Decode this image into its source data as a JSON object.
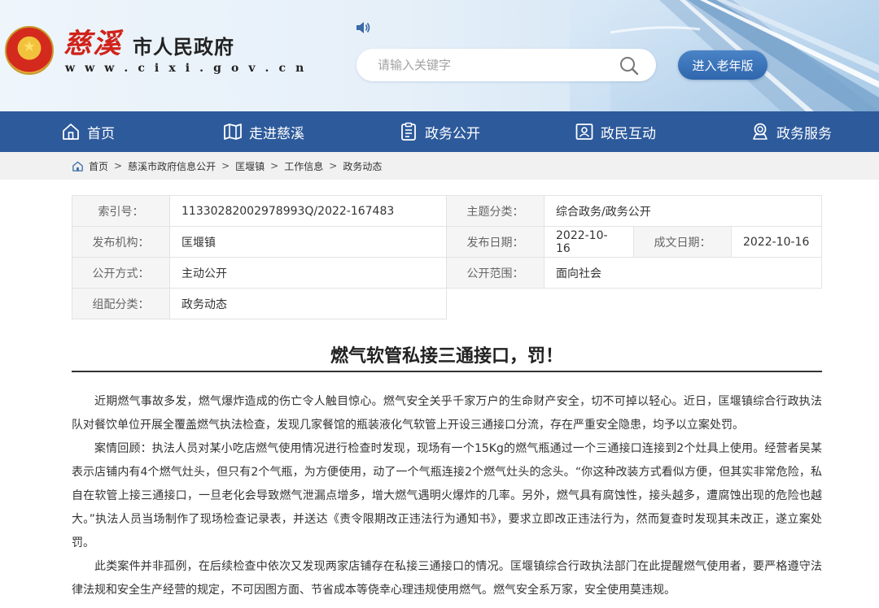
{
  "header": {
    "logo_cursive": "慈溪",
    "site_title": "市人民政府",
    "site_url": "w w w . c i x i . g o v . c n",
    "search_placeholder": "请输入关键字",
    "elder_mode_label": "进入老年版"
  },
  "nav": [
    {
      "label": "首页",
      "icon": "home-icon"
    },
    {
      "label": "走进慈溪",
      "icon": "map-icon"
    },
    {
      "label": "政务公开",
      "icon": "document-list-icon"
    },
    {
      "label": "政民互动",
      "icon": "portrait-icon"
    },
    {
      "label": "政务服务",
      "icon": "service-badge-icon"
    }
  ],
  "breadcrumb": [
    "首页",
    "慈溪市政府信息公开",
    "匡堰镇",
    "工作信息",
    "政务动态"
  ],
  "meta": {
    "index_label": "索引号：",
    "index_value": "11330282002978993Q/2022-167483",
    "topic_label": "主题分类：",
    "topic_value": "综合政务/政务公开",
    "publisher_label": "发布机构：",
    "publisher_value": "匡堰镇",
    "publish_date_label": "发布日期：",
    "publish_date_value": "2022-10-16",
    "creation_date_label": "成文日期：",
    "creation_date_value": "2022-10-16",
    "disclosure_mode_label": "公开方式：",
    "disclosure_mode_value": "主动公开",
    "scope_label": "公开范围：",
    "scope_value": "面向社会",
    "category_label": "组配分类：",
    "category_value": "政务动态"
  },
  "article": {
    "title": "燃气软管私接三通接口，罚！",
    "paragraphs": [
      "近期燃气事故多发，燃气爆炸造成的伤亡令人触目惊心。燃气安全关乎千家万户的生命财产安全，切不可掉以轻心。近日，匡堰镇综合行政执法队对餐饮单位开展全覆盖燃气执法检查，发现几家餐馆的瓶装液化气软管上开设三通接口分流，存在严重安全隐患，均予以立案处罚。",
      "案情回顾：执法人员对某小吃店燃气使用情况进行检查时发现，现场有一个15Kg的燃气瓶通过一个三通接口连接到2个灶具上使用。经营者吴某表示店铺内有4个燃气灶头，但只有2个气瓶，为方便使用，动了一个气瓶连接2个燃气灶头的念头。“你这种改装方式看似方便，但其实非常危险，私自在软管上接三通接口，一旦老化会导致燃气泄漏点增多，增大燃气遇明火爆炸的几率。另外，燃气具有腐蚀性，接头越多，遭腐蚀出现的危险也越大。”执法人员当场制作了现场检查记录表，并送达《责令限期改正违法行为通知书》，要求立即改正违法行为，然而复查时发现其未改正，遂立案处罚。",
      "此类案件并非孤例，在后续检查中依次又发现两家店铺存在私接三通接口的情况。匡堰镇综合行政执法部门在此提醒燃气使用者，要严格遵守法律法规和安全生产经营的规定，不可因图方面、节省成本等侥幸心理违规使用燃气。燃气安全系万家，安全使用莫违规。"
    ]
  }
}
